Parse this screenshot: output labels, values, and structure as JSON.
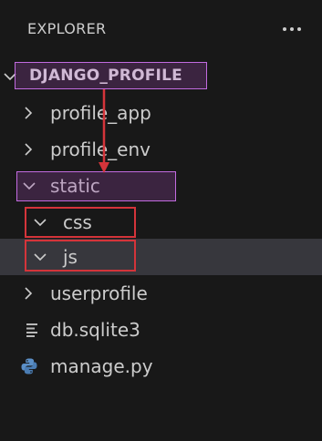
{
  "header": {
    "title": "EXPLORER",
    "more_icon": "ellipsis-icon"
  },
  "tree": {
    "root": {
      "label": "DJANGO_PROFILE",
      "expanded": true
    },
    "items": [
      {
        "label": "profile_app",
        "type": "folder",
        "expanded": false,
        "icon": "chevron-right-icon"
      },
      {
        "label": "profile_env",
        "type": "folder",
        "expanded": false,
        "icon": "chevron-right-icon"
      },
      {
        "label": "static",
        "type": "folder",
        "expanded": true,
        "icon": "chevron-down-icon"
      },
      {
        "label": "css",
        "type": "folder",
        "expanded": true,
        "icon": "chevron-down-icon"
      },
      {
        "label": "js",
        "type": "folder",
        "expanded": true,
        "icon": "chevron-down-icon",
        "selected": true
      },
      {
        "label": "userprofile",
        "type": "folder",
        "expanded": false,
        "icon": "chevron-right-icon"
      },
      {
        "label": "db.sqlite3",
        "type": "file",
        "icon": "database-file-icon"
      },
      {
        "label": "manage.py",
        "type": "file",
        "icon": "python-icon"
      }
    ]
  },
  "annotations": {
    "purple_highlight_color": "#c26be0",
    "red_highlight_color": "#d4343a",
    "arrow_color": "#d4343a"
  }
}
